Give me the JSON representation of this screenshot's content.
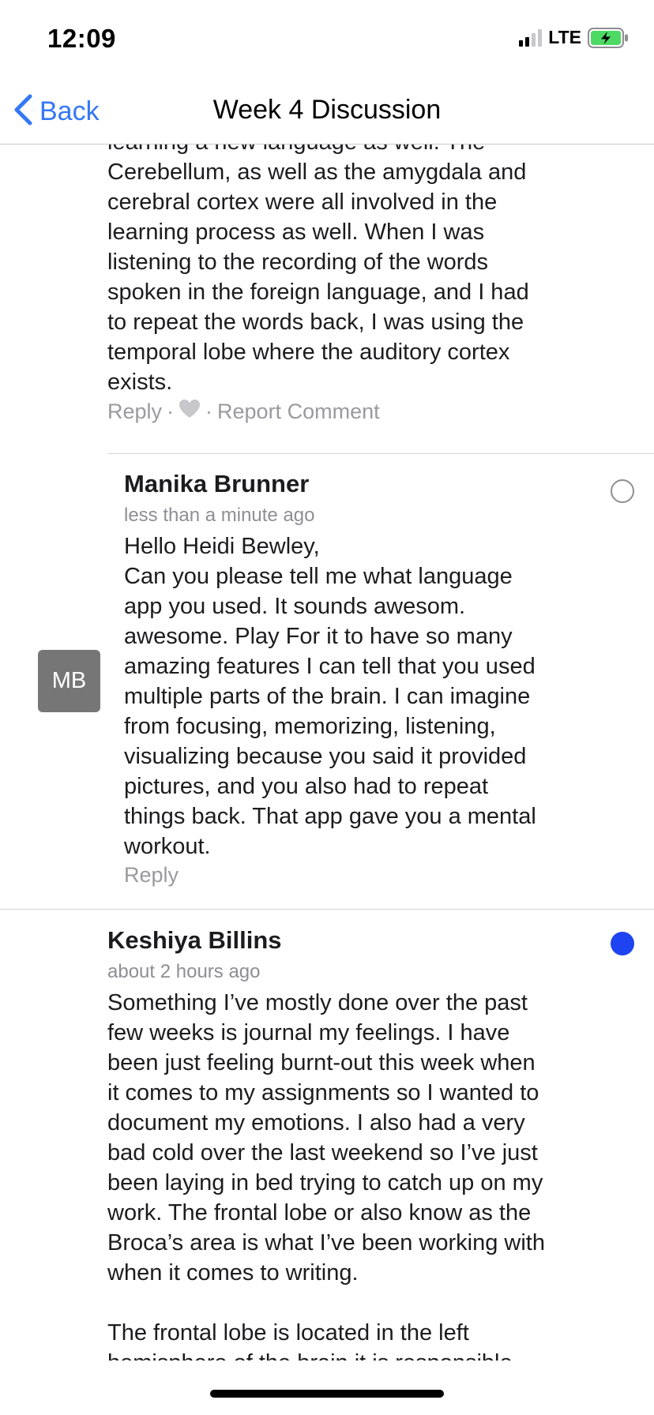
{
  "status": {
    "time": "12:09",
    "network": "LTE"
  },
  "nav": {
    "back_label": "Back",
    "title": "Week 4 Discussion"
  },
  "comment_prev": {
    "lines": [
      "learning a new language as well. The",
      "Cerebellum, as well as the amygdala and",
      "cerebral cortex were all involved in the",
      "learning process as well. When I was",
      "listening to the recording of the words",
      "spoken in the foreign language, and I had",
      "to repeat the words back, I was using the",
      "temporal lobe where the auditory cortex",
      "exists."
    ],
    "reply_label": "Reply",
    "separator": "·",
    "report_label": "Report Comment"
  },
  "reply_comment": {
    "avatar_initials": "MB",
    "author": "Manika Brunner",
    "timestamp": "less than a minute ago",
    "lines": [
      "Hello Heidi Bewley,",
      "Can you please tell me what language",
      "app you used. It sounds awesom.",
      "awesome. Play For it to have so many",
      "amazing features I can tell that you used",
      "multiple parts of the brain. I can imagine",
      "from focusing, memorizing, listening,",
      "visualizing because you said it provided",
      "pictures, and you also had to repeat",
      "things back. That app gave you a mental",
      "workout."
    ],
    "reply_label": "Reply"
  },
  "comment_next": {
    "author": "Keshiya Billins",
    "timestamp": "about 2 hours ago",
    "lines": [
      "Something I’ve mostly done over the past",
      "few weeks is journal my feelings. I have",
      "been just feeling burnt-out this week when",
      "it comes to my assignments so I wanted to",
      "document my emotions. I also had a very",
      "bad cold over the last weekend so I’ve just",
      "been laying in bed trying to catch up on my",
      "work. The frontal lobe or also know as the",
      "Broca’s area is what I’ve been working with",
      "when it comes to writing.",
      "",
      "The frontal lobe is located in the left",
      "hemisphere of the brain it is responsible"
    ]
  },
  "colors": {
    "accent": "#3478f6",
    "unread_dot": "#1e43f0",
    "avatar_bg": "#767676",
    "battery_green": "#4cd964"
  }
}
